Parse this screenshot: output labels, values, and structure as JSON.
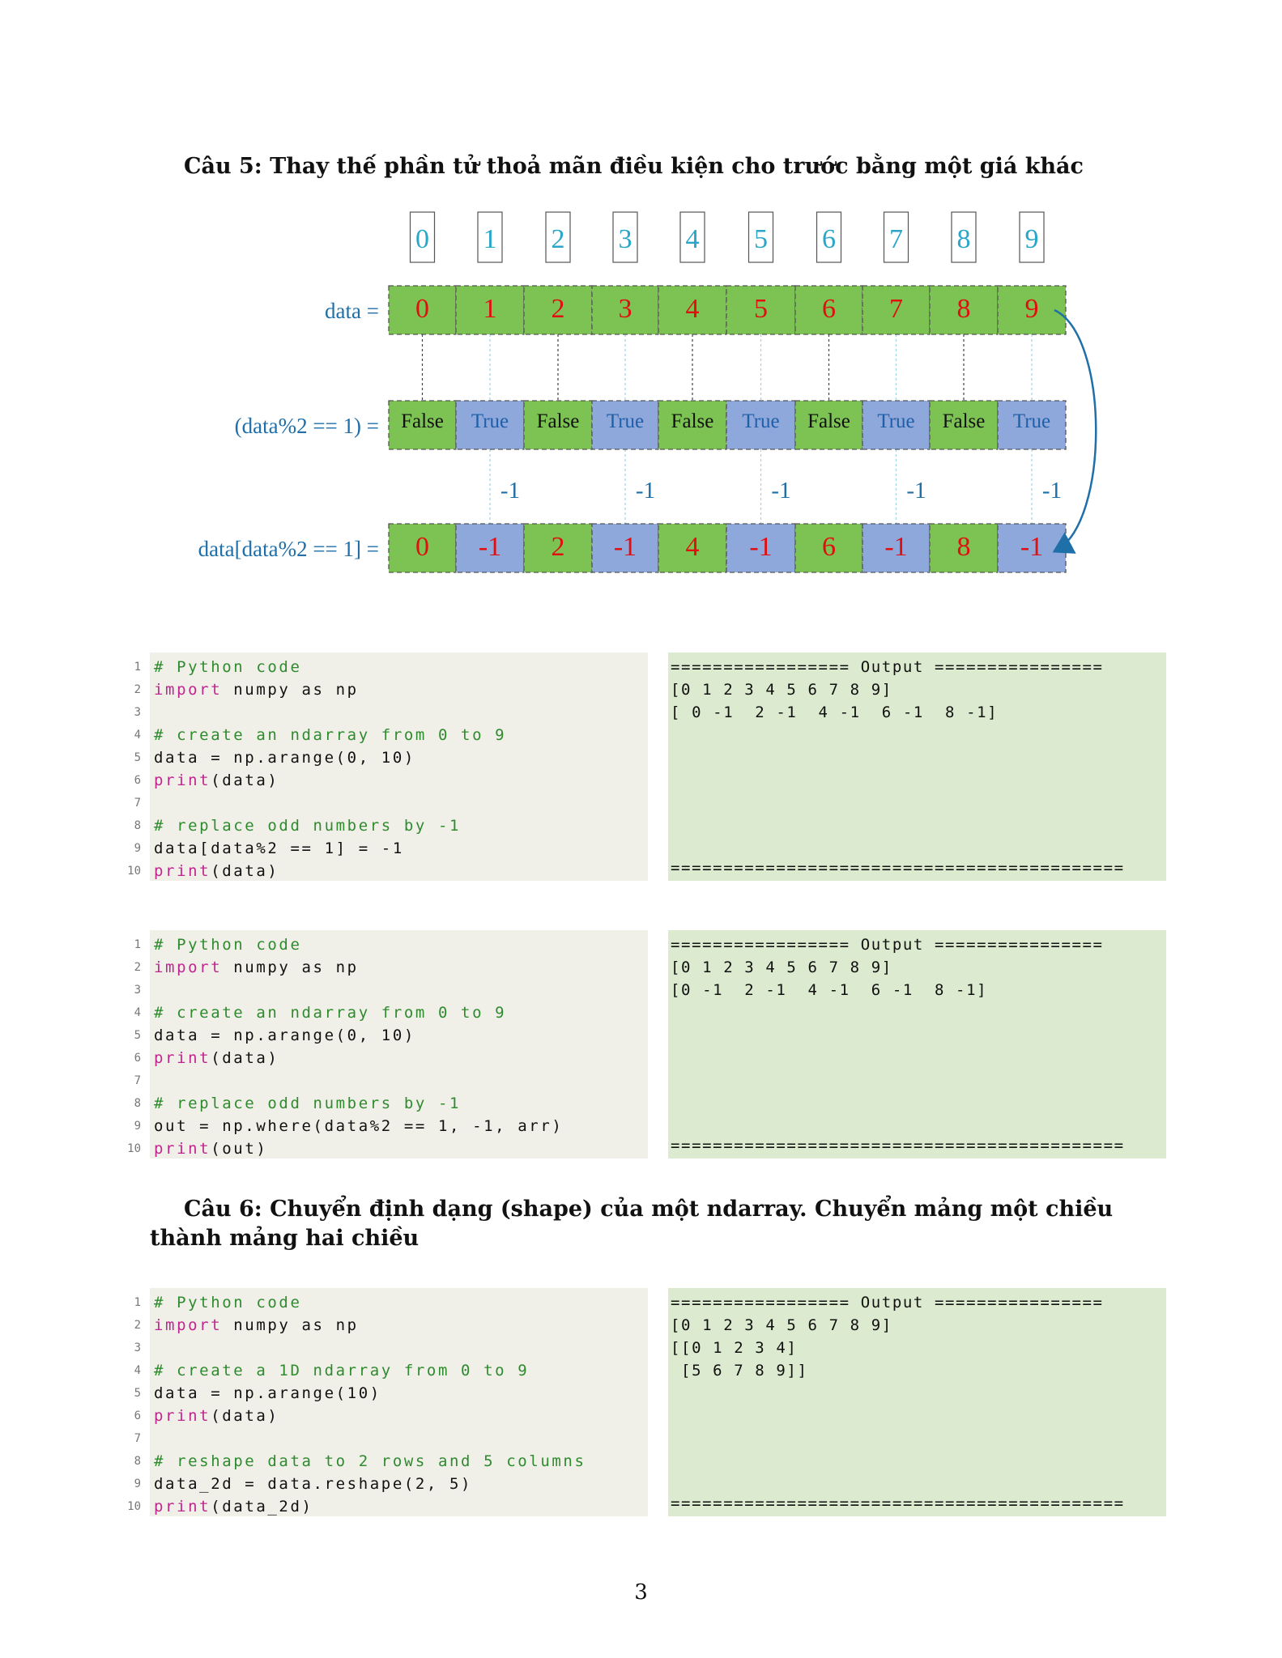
{
  "q5_title": "Câu 5: Thay thế phần tử thoả mãn điều kiện cho trước bằng một giá khác",
  "q6_title": "Câu 6: Chuyển định dạng (shape) của một ndarray. Chuyển mảng một chiều thành mảng hai chiều",
  "diagram": {
    "indices": [
      "0",
      "1",
      "2",
      "3",
      "4",
      "5",
      "6",
      "7",
      "8",
      "9"
    ],
    "row1_label": "data =",
    "row1": [
      "0",
      "1",
      "2",
      "3",
      "4",
      "5",
      "6",
      "7",
      "8",
      "9"
    ],
    "row2_label": "(data%2 == 1) =",
    "row2": [
      "False",
      "True",
      "False",
      "True",
      "False",
      "True",
      "False",
      "True",
      "False",
      "True"
    ],
    "replace_labels": [
      "-1",
      "-1",
      "-1",
      "-1",
      "-1"
    ],
    "row3_label": "data[data%2 == 1] =",
    "row3": [
      "0",
      "-1",
      "2",
      "-1",
      "4",
      "-1",
      "6",
      "-1",
      "8",
      "-1"
    ],
    "colors": {
      "green": "#7dc353",
      "blue": "#8fa8dc",
      "index": "#29a6c9",
      "label": "#1f6fa8",
      "value": "#e01010",
      "true_text": "#1f5fa8"
    }
  },
  "blocks": [
    {
      "code": [
        [
          {
            "t": "# Python code",
            "c": "comment"
          }
        ],
        [
          {
            "t": "import",
            "c": "kw"
          },
          {
            "t": " numpy as np"
          }
        ],
        [],
        [
          {
            "t": "# create an ndarray from 0 to 9",
            "c": "comment"
          }
        ],
        [
          {
            "t": "data = np.arange(0, 10)"
          }
        ],
        [
          {
            "t": "print",
            "c": "kw"
          },
          {
            "t": "(data)"
          }
        ],
        [],
        [
          {
            "t": "# replace odd numbers by -1",
            "c": "comment"
          }
        ],
        [
          {
            "t": "data[data%2 == 1] = -1"
          }
        ],
        [
          {
            "t": "print",
            "c": "kw"
          },
          {
            "t": "(data)"
          }
        ]
      ],
      "output_header": "================= Output ================",
      "output": [
        "[0 1 2 3 4 5 6 7 8 9]",
        "[ 0 -1  2 -1  4 -1  6 -1  8 -1]"
      ],
      "output_footer": "==========================================="
    },
    {
      "code": [
        [
          {
            "t": "# Python code",
            "c": "comment"
          }
        ],
        [
          {
            "t": "import",
            "c": "kw"
          },
          {
            "t": " numpy as np"
          }
        ],
        [],
        [
          {
            "t": "# create an ndarray from 0 to 9",
            "c": "comment"
          }
        ],
        [
          {
            "t": "data = np.arange(0, 10)"
          }
        ],
        [
          {
            "t": "print",
            "c": "kw"
          },
          {
            "t": "(data)"
          }
        ],
        [],
        [
          {
            "t": "# replace odd numbers by -1",
            "c": "comment"
          }
        ],
        [
          {
            "t": "out = np.where(data%2 == 1, -1, arr)"
          }
        ],
        [
          {
            "t": "print",
            "c": "kw"
          },
          {
            "t": "(out)"
          }
        ]
      ],
      "output_header": "================= Output ================",
      "output": [
        "[0 1 2 3 4 5 6 7 8 9]",
        "[0 -1  2 -1  4 -1  6 -1  8 -1]"
      ],
      "output_footer": "==========================================="
    },
    {
      "code": [
        [
          {
            "t": "# Python code",
            "c": "comment"
          }
        ],
        [
          {
            "t": "import",
            "c": "kw"
          },
          {
            "t": " numpy as np"
          }
        ],
        [],
        [
          {
            "t": "# create a 1D ndarray from 0 to 9",
            "c": "comment"
          }
        ],
        [
          {
            "t": "data = np.arange(10)"
          }
        ],
        [
          {
            "t": "print",
            "c": "kw"
          },
          {
            "t": "(data)"
          }
        ],
        [],
        [
          {
            "t": "# reshape data to 2 rows and 5 columns",
            "c": "comment"
          }
        ],
        [
          {
            "t": "data_2d = data.reshape(2, 5)"
          }
        ],
        [
          {
            "t": "print",
            "c": "kw"
          },
          {
            "t": "(data_2d)"
          }
        ]
      ],
      "output_header": "================= Output ================",
      "output": [
        "[0 1 2 3 4 5 6 7 8 9]",
        "[[0 1 2 3 4]",
        " [5 6 7 8 9]]"
      ],
      "output_footer": "==========================================="
    }
  ],
  "page_number": "3"
}
